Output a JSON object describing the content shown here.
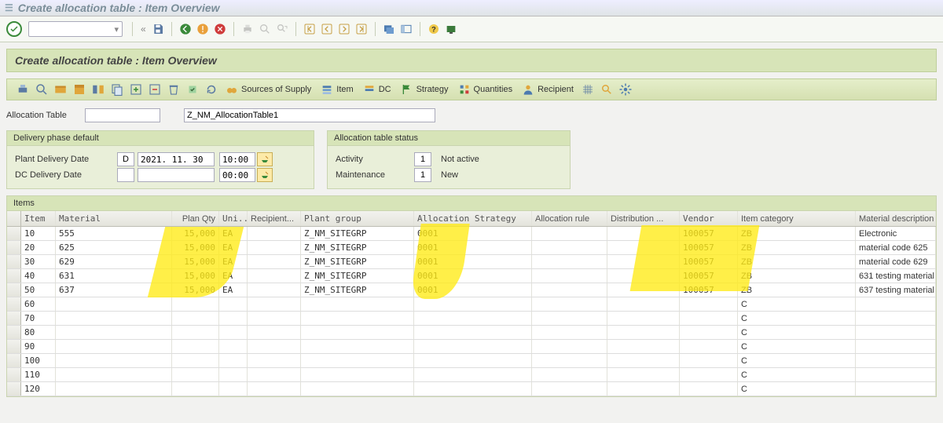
{
  "window_title": "Create allocation table : Item Overview",
  "page_title": "Create allocation table : Item Overview",
  "tb2": {
    "sources": "Sources of Supply",
    "item": "Item",
    "dc": "DC",
    "strategy": "Strategy",
    "quantities": "Quantities",
    "recipient": "Recipient"
  },
  "form": {
    "alloc_table_label": "Allocation Table",
    "alloc_table_id": "",
    "alloc_table_name": "Z_NM_AllocationTable1"
  },
  "panel1": {
    "title": "Delivery phase default",
    "plant_lbl": "Plant Delivery Date",
    "plant_flag": "D",
    "plant_date": "2021. 11. 30",
    "plant_time": "10:00",
    "dc_lbl": "DC Delivery Date",
    "dc_flag": "",
    "dc_date": "",
    "dc_time": "00:00"
  },
  "panel2": {
    "title": "Allocation table status",
    "activity_lbl": "Activity",
    "activity_code": "1",
    "activity_txt": "Not active",
    "maint_lbl": "Maintenance",
    "maint_code": "1",
    "maint_txt": "New"
  },
  "grid": {
    "title": "Items",
    "cols": {
      "item": "Item",
      "material": "Material",
      "planqty": "Plan Qty",
      "uni": "Uni...",
      "recipient": "Recipient...",
      "plantgroup": "Plant group",
      "allocstrat": "Allocation Strategy",
      "allocrule": "Allocation rule",
      "dist": "Distribution ...",
      "vendor": "Vendor",
      "itemcat": "Item category",
      "matdesc": "Material description"
    },
    "rows": [
      {
        "item": "10",
        "material": "555",
        "qty": "15,000",
        "uni": "EA",
        "pg": "Z_NM_SITEGRP",
        "as": "0001",
        "ven": "100057",
        "ic": "ZB",
        "md": "Electronic"
      },
      {
        "item": "20",
        "material": "625",
        "qty": "15,000",
        "uni": "EA",
        "pg": "Z_NM_SITEGRP",
        "as": "0001",
        "ven": "100057",
        "ic": "ZB",
        "md": "material code 625"
      },
      {
        "item": "30",
        "material": "629",
        "qty": "15,000",
        "uni": "EA",
        "pg": "Z_NM_SITEGRP",
        "as": "0001",
        "ven": "100057",
        "ic": "ZB",
        "md": "material code 629"
      },
      {
        "item": "40",
        "material": "631",
        "qty": "15,000",
        "uni": "EA",
        "pg": "Z_NM_SITEGRP",
        "as": "0001",
        "ven": "100057",
        "ic": "ZB",
        "md": "631 testing material"
      },
      {
        "item": "50",
        "material": "637",
        "qty": "15,000",
        "uni": "EA",
        "pg": "Z_NM_SITEGRP",
        "as": "0001",
        "ven": "100057",
        "ic": "ZB",
        "md": "637 testing material"
      },
      {
        "item": "60",
        "material": "",
        "qty": "",
        "uni": "",
        "pg": "",
        "as": "",
        "ven": "",
        "ic": "C",
        "md": ""
      },
      {
        "item": "70",
        "material": "",
        "qty": "",
        "uni": "",
        "pg": "",
        "as": "",
        "ven": "",
        "ic": "C",
        "md": ""
      },
      {
        "item": "80",
        "material": "",
        "qty": "",
        "uni": "",
        "pg": "",
        "as": "",
        "ven": "",
        "ic": "C",
        "md": ""
      },
      {
        "item": "90",
        "material": "",
        "qty": "",
        "uni": "",
        "pg": "",
        "as": "",
        "ven": "",
        "ic": "C",
        "md": ""
      },
      {
        "item": "100",
        "material": "",
        "qty": "",
        "uni": "",
        "pg": "",
        "as": "",
        "ven": "",
        "ic": "C",
        "md": ""
      },
      {
        "item": "110",
        "material": "",
        "qty": "",
        "uni": "",
        "pg": "",
        "as": "",
        "ven": "",
        "ic": "C",
        "md": ""
      },
      {
        "item": "120",
        "material": "",
        "qty": "",
        "uni": "",
        "pg": "",
        "as": "",
        "ven": "",
        "ic": "C",
        "md": ""
      }
    ]
  }
}
